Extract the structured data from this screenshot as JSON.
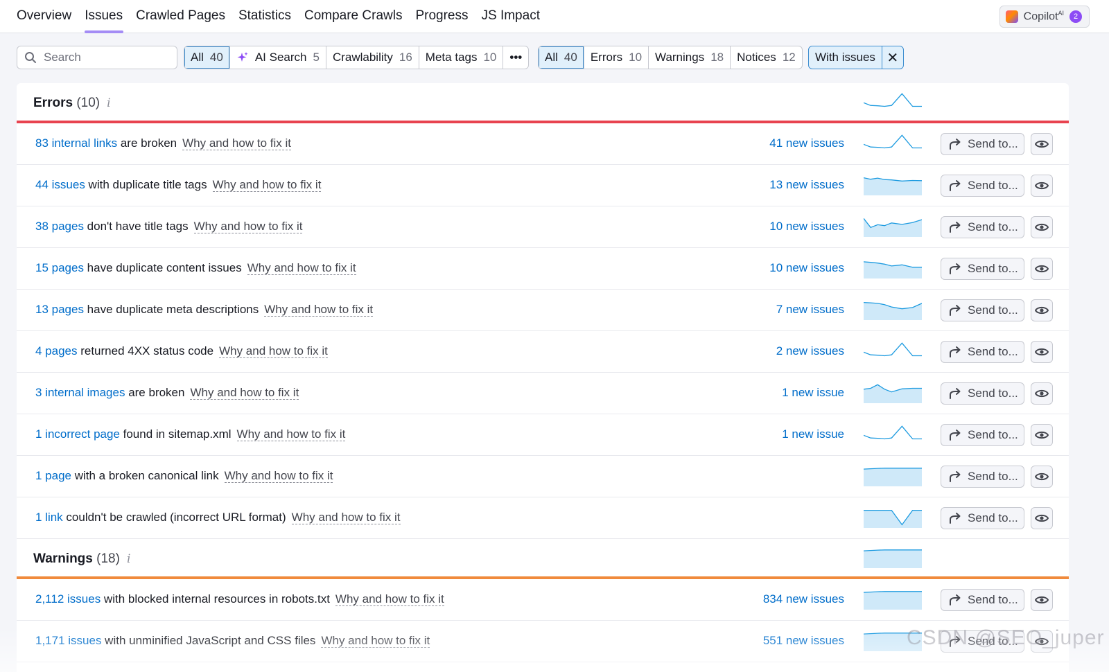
{
  "nav": {
    "tabs": [
      "Overview",
      "Issues",
      "Crawled Pages",
      "Statistics",
      "Compare Crawls",
      "Progress",
      "JS Impact"
    ],
    "active_tab": "Issues",
    "copilot": {
      "label": "Copilot",
      "sup": "AI",
      "badge": "2"
    }
  },
  "filters": {
    "search_placeholder": "Search",
    "category": [
      {
        "label": "All",
        "count": "40",
        "selected": true
      },
      {
        "label": "AI Search",
        "count": "5",
        "selected": false
      },
      {
        "label": "Crawlability",
        "count": "16",
        "selected": false
      },
      {
        "label": "Meta tags",
        "count": "10",
        "selected": false
      }
    ],
    "more_label": "•••",
    "severity": [
      {
        "label": "All",
        "count": "40",
        "selected": true
      },
      {
        "label": "Errors",
        "count": "10",
        "selected": false
      },
      {
        "label": "Warnings",
        "count": "18",
        "selected": false
      },
      {
        "label": "Notices",
        "count": "12",
        "selected": false
      }
    ],
    "with_issues_label": "With issues",
    "close_glyph": "✕"
  },
  "colors": {
    "errors_line": "#e8434f",
    "warnings_line": "#f08a3c",
    "link": "#006dca",
    "spark_stroke": "#1d9be0",
    "spark_fill": "#cfe9f9"
  },
  "why_label": "Why and how to fix it",
  "send_label": "Send to...",
  "sections": [
    {
      "title": "Errors",
      "count": "(10)",
      "spark": "peak",
      "rows": [
        {
          "link": "83 internal links",
          "text": " are broken",
          "new": "41 new issues",
          "spark": "peak"
        },
        {
          "link": "44 issues",
          "text": " with duplicate title tags",
          "new": "13 new issues",
          "spark": "wave"
        },
        {
          "link": "38 pages",
          "text": " don't have title tags",
          "new": "10 new issues",
          "spark": "rise"
        },
        {
          "link": "15 pages",
          "text": " have duplicate content issues",
          "new": "10 new issues",
          "spark": "decline"
        },
        {
          "link": "13 pages",
          "text": " have duplicate meta descriptions",
          "new": "7 new issues",
          "spark": "dip"
        },
        {
          "link": "4 pages",
          "text": " returned 4XX status code",
          "new": "2 new issues",
          "spark": "peak"
        },
        {
          "link": "3 internal images",
          "text": " are broken",
          "new": "1 new issue",
          "spark": "bump"
        },
        {
          "link": "1 incorrect page",
          "text": " found in sitemap.xml",
          "new": "1 new issue",
          "spark": "peak"
        },
        {
          "link": "1 page",
          "text": " with a broken canonical link",
          "new": "",
          "spark": "flat"
        },
        {
          "link": "1 link",
          "text": " couldn't be crawled (incorrect URL format)",
          "new": "",
          "spark": "valley"
        }
      ]
    },
    {
      "title": "Warnings",
      "count": "(18)",
      "spark": "flat",
      "rows": [
        {
          "link": "2,112 issues",
          "text": " with blocked internal resources in robots.txt",
          "new": "834 new issues",
          "spark": "flat"
        },
        {
          "link": "1,171 issues",
          "text": " with unminified JavaScript and CSS files",
          "new": "551 new issues",
          "spark": "flat"
        }
      ]
    }
  ],
  "watermark": "CSDN @SEO_juper"
}
